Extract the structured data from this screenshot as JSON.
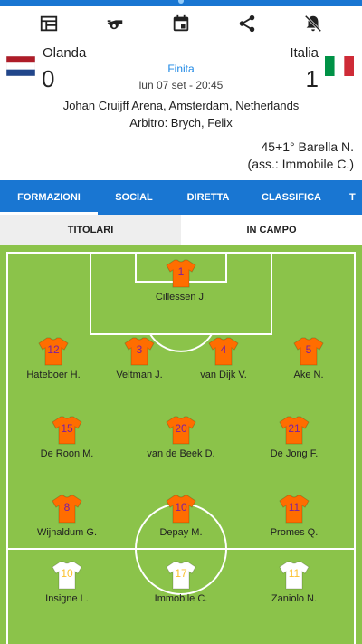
{
  "app": {
    "accent_color": "#1976d2",
    "pitch_color": "#8bc34a"
  },
  "toolbar": {
    "icons": [
      "lineup-icon",
      "whistle-icon",
      "calendar-icon",
      "share-icon",
      "bell-off-icon"
    ]
  },
  "match": {
    "home_team": "Olanda",
    "away_team": "Italia",
    "home_score": "0",
    "away_score": "1",
    "status": "Finita",
    "date": "lun 07 set - 20:45",
    "venue": "Johan Cruijff Arena, Amsterdam, Netherlands",
    "referee": "Arbitro: Brych, Felix",
    "goal": "45+1° Barella N.",
    "assist": "(ass.: Immobile C.)"
  },
  "tabs": [
    "FORMAZIONI",
    "SOCIAL",
    "DIRETTA",
    "CLASSIFICA",
    "T"
  ],
  "subtabs": [
    "TITOLARI",
    "IN CAMPO"
  ],
  "home_players": [
    {
      "number": "1",
      "name": "Cillessen J."
    },
    {
      "number": "12",
      "name": "Hateboer H."
    },
    {
      "number": "3",
      "name": "Veltman J."
    },
    {
      "number": "4",
      "name": "van Dijk V."
    },
    {
      "number": "5",
      "name": "Ake N."
    },
    {
      "number": "15",
      "name": "De Roon M."
    },
    {
      "number": "20",
      "name": "van de Beek D."
    },
    {
      "number": "21",
      "name": "De Jong F."
    },
    {
      "number": "8",
      "name": "Wijnaldum G."
    },
    {
      "number": "10",
      "name": "Depay M."
    },
    {
      "number": "11",
      "name": "Promes Q."
    }
  ],
  "away_players": [
    {
      "number": "10",
      "name": "Insigne L."
    },
    {
      "number": "17",
      "name": "Immobile C."
    },
    {
      "number": "11",
      "name": "Zaniolo N."
    }
  ],
  "colors": {
    "home_shirt": "#ff6d00",
    "home_number": "#7b1fa2",
    "away_shirt": "#ffffff",
    "away_number": "#fbc02d"
  }
}
